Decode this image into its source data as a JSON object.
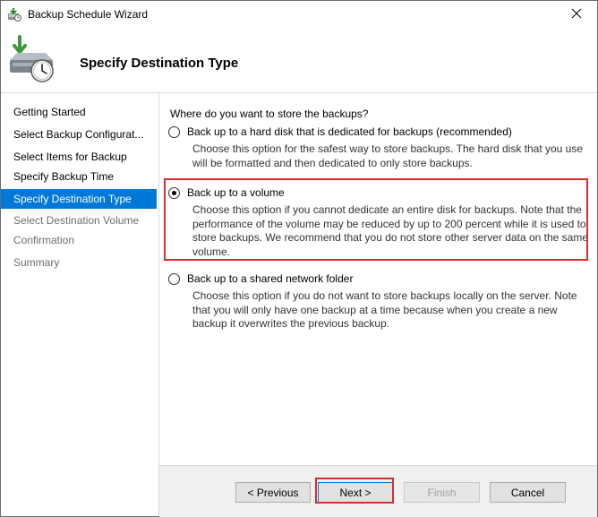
{
  "window": {
    "title": "Backup Schedule Wizard",
    "close_icon": "close-icon"
  },
  "header": {
    "title": "Specify Destination Type",
    "icon": "backup-clock-icon"
  },
  "sidebar": {
    "steps": [
      {
        "label": "Getting Started",
        "state": "normal"
      },
      {
        "label": "Select Backup Configurat...",
        "state": "normal"
      },
      {
        "label": "Select Items for Backup",
        "state": "normal"
      },
      {
        "label": "Specify Backup Time",
        "state": "normal"
      },
      {
        "label": "Specify Destination Type",
        "state": "active"
      },
      {
        "label": "Select Destination Volume",
        "state": "disabled"
      },
      {
        "label": "Confirmation",
        "state": "disabled"
      },
      {
        "label": "Summary",
        "state": "disabled"
      }
    ]
  },
  "main": {
    "question": "Where do you want to store the backups?",
    "options": [
      {
        "label": "Back up to a hard disk that is dedicated for backups (recommended)",
        "description": "Choose this option for the safest way to store backups. The hard disk that you use will be formatted and then dedicated to only store backups.",
        "selected": false
      },
      {
        "label": "Back up to a volume",
        "description": "Choose this option if you cannot dedicate an entire disk for backups. Note that the performance of the volume may be reduced by up to 200 percent while it is used to store backups. We recommend that you do not store other server data on the same volume.",
        "selected": true
      },
      {
        "label": "Back up to a shared network folder",
        "description": "Choose this option if you do not want to store backups locally on the server. Note that you will only have one backup at a time because when you create a new backup it overwrites the previous backup.",
        "selected": false
      }
    ]
  },
  "footer": {
    "previous_label": "< Previous",
    "next_label": "Next >",
    "finish_label": "Finish",
    "cancel_label": "Cancel"
  },
  "colors": {
    "accent": "#0078d7",
    "annotation": "#d32f2f"
  }
}
